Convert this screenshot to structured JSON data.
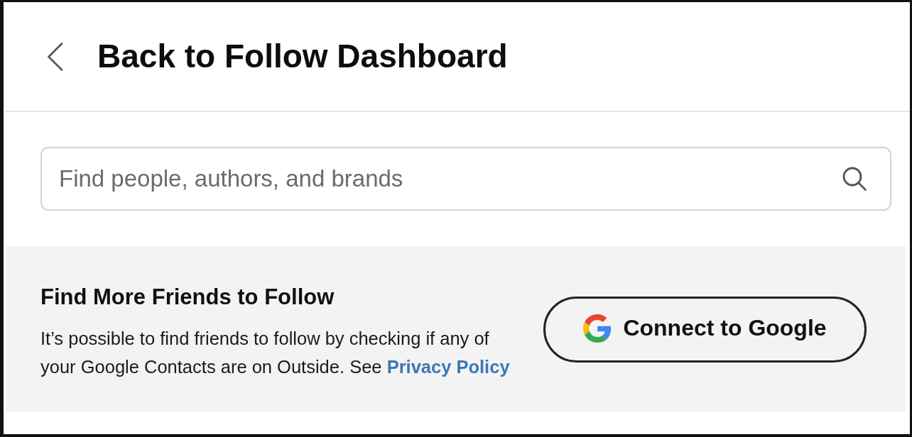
{
  "header": {
    "title": "Back to Follow Dashboard"
  },
  "search": {
    "placeholder": "Find people, authors, and brands"
  },
  "friends_section": {
    "heading": "Find More Friends to Follow",
    "description": "It’s possible to find friends to follow by checking if any of your Google Contacts are on Outside. See",
    "link": "Privacy Policy",
    "button": "Connect to Google"
  }
}
